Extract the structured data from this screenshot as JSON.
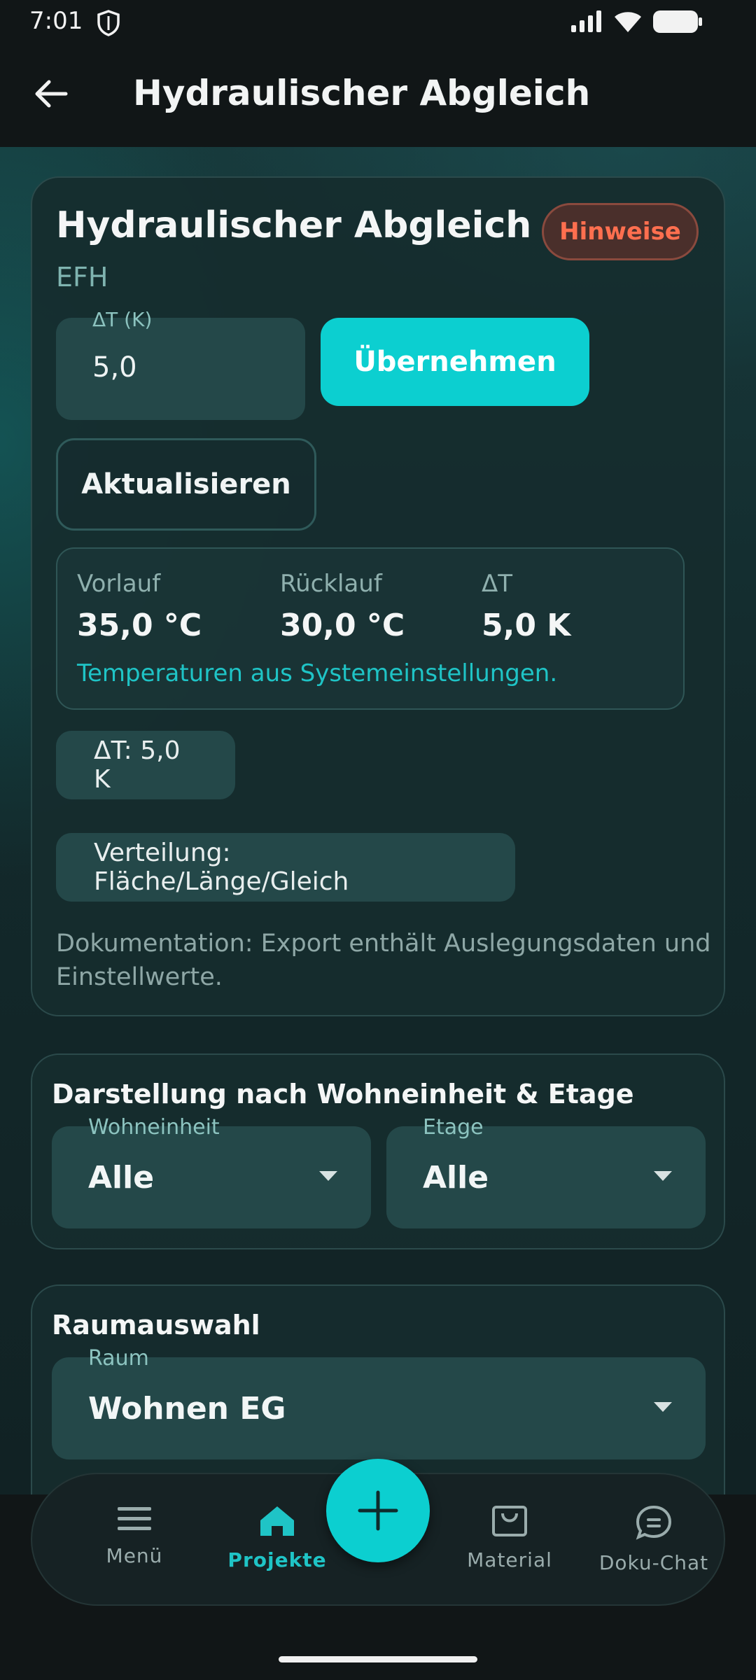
{
  "status": {
    "time": "7:01"
  },
  "appbar": {
    "title": "Hydraulischer Abgleich"
  },
  "card1": {
    "title": "Hydraulischer Abgleich",
    "subtitle": "EFH",
    "hinweise": "Hinweise",
    "delta_field": {
      "label": "ΔT (K)",
      "value": "5,0"
    },
    "apply_button": "Übernehmen",
    "refresh_button": "Aktualisieren",
    "temps": {
      "vorlauf_label": "Vorlauf",
      "vorlauf_value": "35,0 °C",
      "ruecklauf_label": "Rücklauf",
      "ruecklauf_value": "30,0 °C",
      "dt_label": "ΔT",
      "dt_value": "5,0 K",
      "note": "Temperaturen aus Systemeinstellungen."
    },
    "chip_dt": "ΔT: 5,0 K",
    "chip_distribution": "Verteilung: Fläche/Länge/Gleich",
    "doc_note": "Dokumentation: Export enthält Auslegungsdaten und Einstellwerte."
  },
  "card2": {
    "title": "Darstellung nach Wohneinheit & Etage",
    "wohneinheit": {
      "label": "Wohneinheit",
      "value": "Alle"
    },
    "etage": {
      "label": "Etage",
      "value": "Alle"
    }
  },
  "card3": {
    "title": "Raumauswahl",
    "raum": {
      "label": "Raum",
      "value": "Wohnen EG"
    }
  },
  "nav": {
    "menu": "Menü",
    "projects": "Projekte",
    "material": "Material",
    "chat": "Doku-Chat"
  },
  "colors": {
    "accent": "#0ccfd0",
    "warning": "#ff6f4f",
    "background": "#13292b"
  }
}
